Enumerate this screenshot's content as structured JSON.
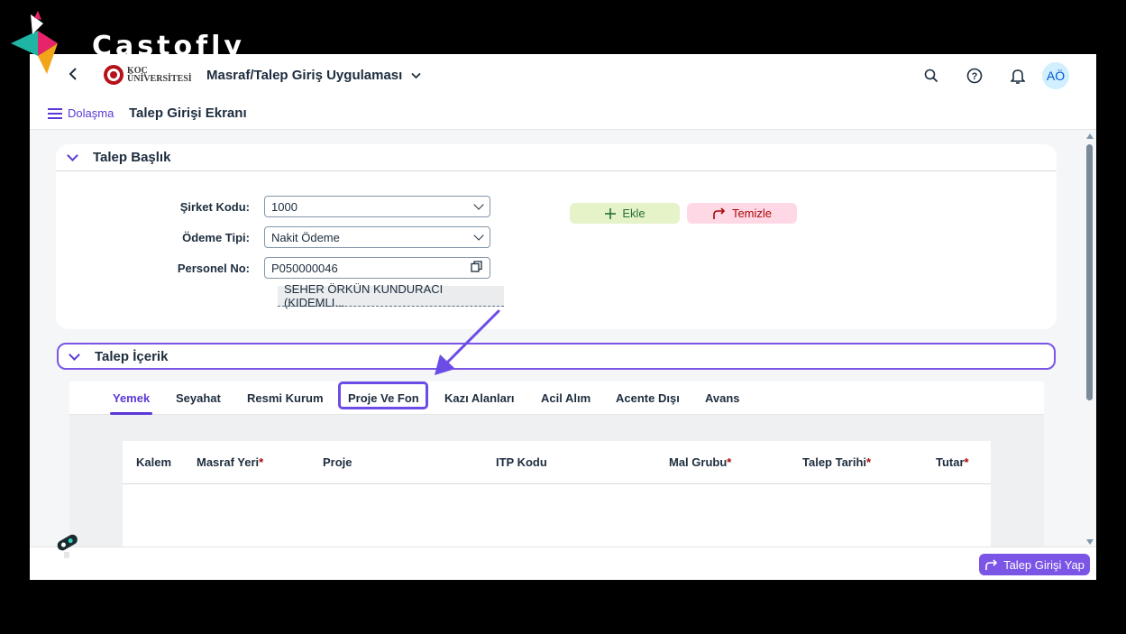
{
  "watermark": {
    "text": "Castofly"
  },
  "shell": {
    "logo_line1": "KOÇ",
    "logo_line2": "ÜNİVERSİTESİ",
    "app_title": "Masraf/Talep Giriş Uygulaması",
    "avatar_initials": "AÖ",
    "icons": [
      "search-icon",
      "help-icon",
      "bell-icon"
    ]
  },
  "subheader": {
    "nav_label": "Dolaşma",
    "page_title": "Talep Girişi Ekranı"
  },
  "header_section": {
    "title": "Talep Başlık",
    "fields": {
      "company_code_label": "Şirket Kodu:",
      "company_code_value": "1000",
      "payment_type_label": "Ödeme Tipi:",
      "payment_type_value": "Nakit Ödeme",
      "personnel_label": "Personel No:",
      "personnel_value": "P050000046",
      "personnel_name": "SEHER ÖRKÜN KUNDURACI (KIDEMLI..."
    },
    "add_label": "Ekle",
    "clear_label": "Temizle"
  },
  "content_section": {
    "title": "Talep İçerik",
    "tabs": [
      "Yemek",
      "Seyahat",
      "Resmi Kurum",
      "Proje Ve Fon",
      "Kazı Alanları",
      "Acil Alım",
      "Acente Dışı",
      "Avans"
    ],
    "active_tab": "Yemek",
    "highlighted_tab": "Proje Ve Fon",
    "table_headers": [
      "Kalem",
      "Masraf Yeri",
      "Proje",
      "ITP Kodu",
      "Mal Grubu",
      "Talep Tarihi",
      "Tutar"
    ],
    "required_marker": "*"
  },
  "footer": {
    "submit_label": "Talep Girişi Yap"
  },
  "colors": {
    "accent": "#5b38d6",
    "highlight": "#6c4ce6",
    "add_bg": "#e6f3c8",
    "clear_bg": "#ffd8e5",
    "required": "#aa0808"
  }
}
